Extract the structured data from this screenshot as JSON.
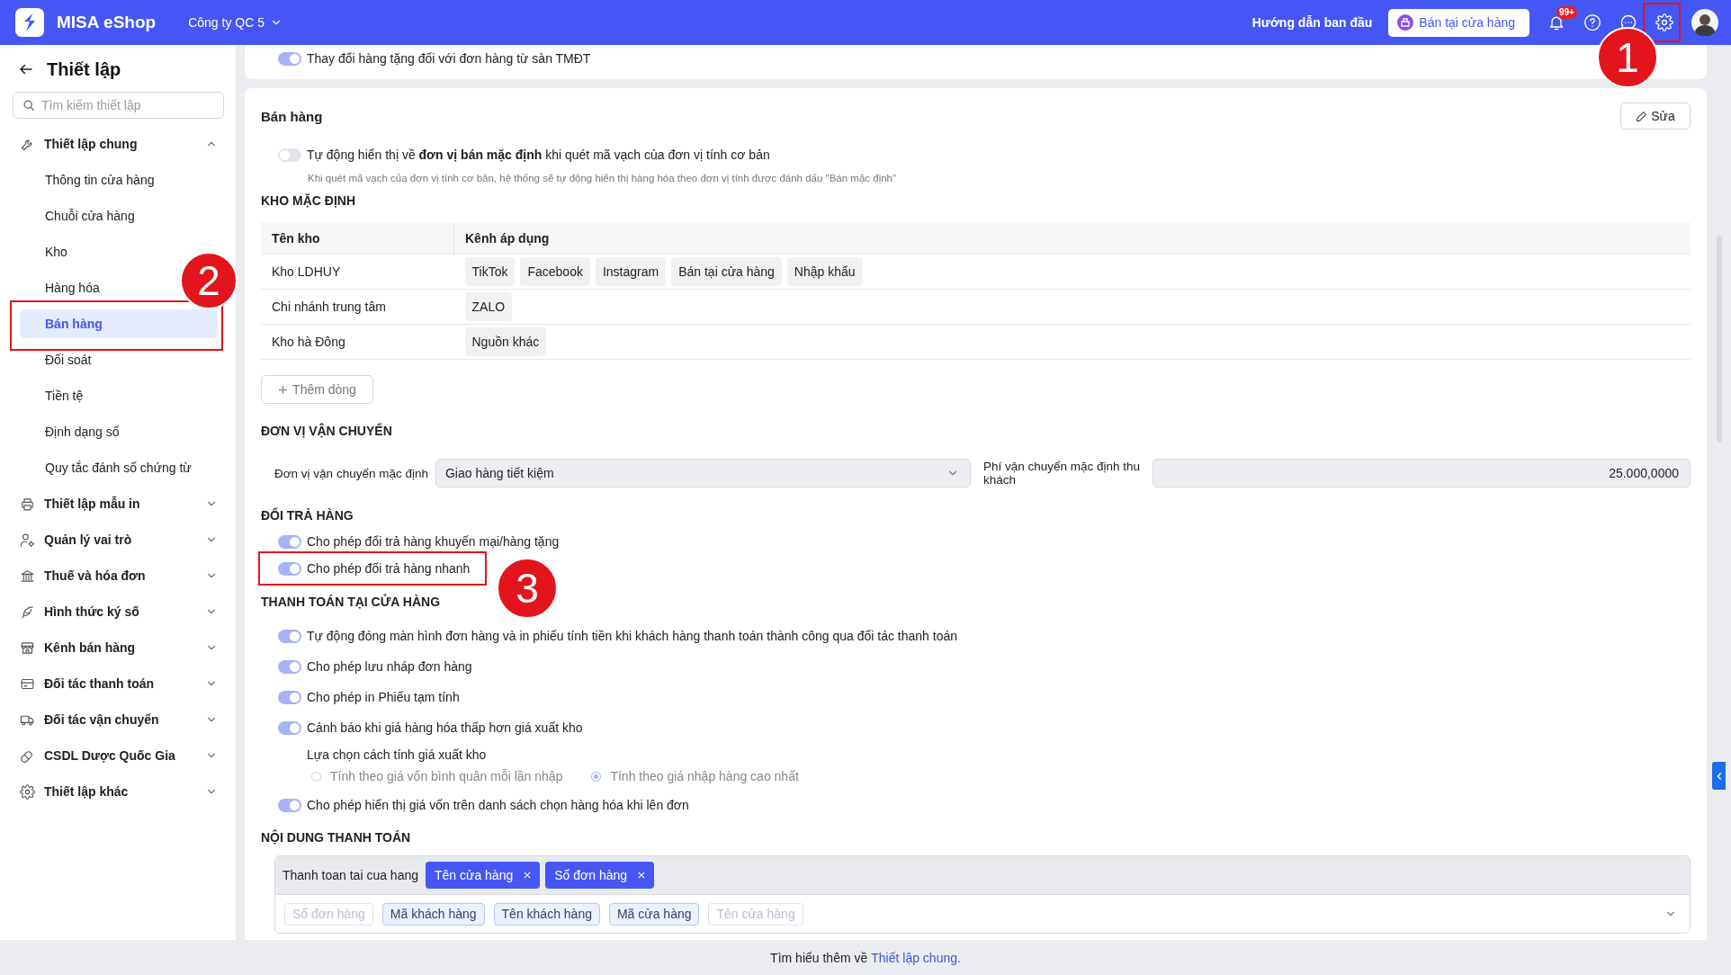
{
  "topbar": {
    "brand": "MISA eShop",
    "company": "Công ty QC 5",
    "guide_link": "Hướng dẫn ban đầu",
    "store_button": "Bán tại cửa hàng",
    "notification_badge": "99+"
  },
  "sidebar": {
    "title": "Thiết lập",
    "search": {
      "placeholder": "Tìm kiếm thiết lập"
    },
    "groups": [
      {
        "label": "Thiết lập chung",
        "expanded": true,
        "children": [
          {
            "label": "Thông tin cửa hàng",
            "selected": false
          },
          {
            "label": "Chuỗi cửa hàng",
            "selected": false
          },
          {
            "label": "Kho",
            "selected": false
          },
          {
            "label": "Hàng hóa",
            "selected": false
          },
          {
            "label": "Bán hàng",
            "selected": true
          },
          {
            "label": "Đối soát",
            "selected": false
          },
          {
            "label": "Tiền tệ",
            "selected": false
          },
          {
            "label": "Định dạng số",
            "selected": false
          },
          {
            "label": "Quy tắc đánh số chứng từ",
            "selected": false
          }
        ]
      },
      {
        "label": "Thiết lập mẫu in",
        "expanded": false
      },
      {
        "label": "Quản lý vai trò",
        "expanded": false
      },
      {
        "label": "Thuế và hóa đơn",
        "expanded": false
      },
      {
        "label": "Hình thức ký số",
        "expanded": false
      },
      {
        "label": "Kênh bán hàng",
        "expanded": false
      },
      {
        "label": "Đối tác thanh toán",
        "expanded": false
      },
      {
        "label": "Đối tác vận chuyển",
        "expanded": false
      },
      {
        "label": "CSDL Dược Quốc Gia",
        "expanded": false
      },
      {
        "label": "Thiết lập khác",
        "expanded": false
      }
    ]
  },
  "top_card": {
    "toggle": {
      "label": "Thay đổi hàng tặng đối với đơn hàng từ sàn TMĐT",
      "on": true
    }
  },
  "sales": {
    "title": "Bán hàng",
    "edit_button": "Sửa",
    "barcode_toggle": {
      "label": "Tự động hiển thị về **đơn vị bán mặc định** khi quét mã vạch của đơn vị tính cơ bản",
      "on": false,
      "hint": "Khi quét mã vạch của đơn vị tính cơ bản, hệ thống sẽ tự động hiển thị hàng hóa theo đơn vị tính được đánh dấu \"Bán mặc định\""
    },
    "default_warehouse": {
      "heading": "KHO MẶC ĐỊNH",
      "columns": [
        "Tên kho",
        "Kênh áp dụng"
      ],
      "rows": [
        {
          "name": "Kho LDHUY",
          "channels": [
            "TikTok",
            "Facebook",
            "Instagram",
            "Bán tại cửa hàng",
            "Nhập khẩu"
          ]
        },
        {
          "name": "Chi nhánh trung tâm",
          "channels": [
            "ZALO"
          ]
        },
        {
          "name": "Kho hà Đông",
          "channels": [
            "Nguồn khác"
          ]
        }
      ],
      "add_row_button": "Thêm dòng"
    },
    "shipping": {
      "heading": "ĐƠN VỊ VẬN CHUYỂN",
      "carrier_label": "Đơn vị vận chuyển mặc định",
      "carrier_value": "Giao hàng tiết kiệm",
      "fee_label": "Phí vận chuyển mặc định thu khách",
      "fee_value": "25.000,0000"
    },
    "returns": {
      "heading": "ĐỔI TRẢ HÀNG",
      "toggles": [
        {
          "label": "Cho phép đổi trả hàng khuyến mại/hàng tặng",
          "on": true
        },
        {
          "label": "Cho phép đổi trả hàng nhanh",
          "on": true
        }
      ]
    },
    "store_payment": {
      "heading": "THANH TOÁN TẠI CỬA HÀNG",
      "items": [
        {
          "kind": "toggle",
          "label": "Tự động đóng màn hình đơn hàng và in phiếu tính tiền khi khách hàng thanh toán thành công qua đối tác thanh toán",
          "on": true
        },
        {
          "kind": "toggle",
          "label": "Cho phép lưu nháp đơn hàng",
          "on": true
        },
        {
          "kind": "toggle",
          "label": "Cho phép in Phiếu tạm tính",
          "on": true
        },
        {
          "kind": "toggle",
          "label": "Cảnh báo khi giá hàng hóa thấp hơn giá xuất kho",
          "on": true
        },
        {
          "kind": "radio_group",
          "label": "Lựa chọn cách tính giá xuất kho",
          "options": [
            {
              "label": "Tính theo giá vốn bình quân mỗi lần nhập",
              "selected": false
            },
            {
              "label": "Tính theo giá nhập hàng cao nhất",
              "selected": true
            }
          ]
        },
        {
          "kind": "toggle",
          "label": "Cho phép hiển thị giá vốn trên danh sách chọn hàng hóa khi lên đơn",
          "on": true
        }
      ]
    },
    "payment_content": {
      "heading": "NỘI DUNG THANH TOÁN",
      "prefix": "Thanh toan tai cua hang",
      "selected_tags": [
        "Tên cửa hàng",
        "Số đơn hàng"
      ],
      "options": [
        {
          "label": "Số đơn hàng",
          "disabled": true
        },
        {
          "label": "Mã khách hàng",
          "disabled": false
        },
        {
          "label": "Tên khách hàng",
          "disabled": false
        },
        {
          "label": "Mã cửa hàng",
          "disabled": false
        },
        {
          "label": "Tên cửa hàng",
          "disabled": true
        }
      ]
    }
  },
  "footer": {
    "text": "Tìm hiểu thêm về",
    "link": "Thiết lập chung."
  },
  "annotations": [
    {
      "label": "1"
    },
    {
      "label": "2"
    },
    {
      "label": "3"
    }
  ]
}
